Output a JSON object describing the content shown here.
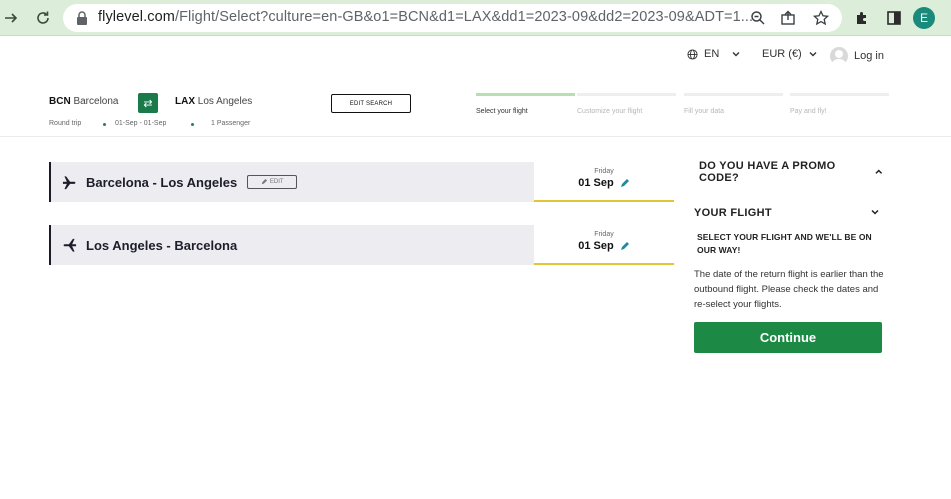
{
  "browser": {
    "url_host": "flylevel.com",
    "url_rest": "/Flight/Select?culture=en-GB&o1=BCN&d1=LAX&dd1=2023-09&dd2=2023-09&ADT=1...",
    "profile_initial": "E"
  },
  "topbar": {
    "language": "EN",
    "currency": "EUR (€)",
    "login": "Log in"
  },
  "search": {
    "origin_code": "BCN",
    "origin_city": "Barcelona",
    "dest_code": "LAX",
    "dest_city": "Los Angeles",
    "trip_type": "Round trip",
    "dates": "01-Sep - 01-Sep",
    "passengers": "1 Passenger",
    "edit_label": "EDIT SEARCH"
  },
  "steps": [
    {
      "label": "Select your flight",
      "active": true
    },
    {
      "label": "Customize your flight",
      "active": false
    },
    {
      "label": "Fill your data",
      "active": false
    },
    {
      "label": "Pay and fly!",
      "active": false
    }
  ],
  "flights": [
    {
      "route": "Barcelona - Los Angeles",
      "edit": "EDIT",
      "day": "Friday",
      "date": "01 Sep"
    },
    {
      "route": "Los Angeles - Barcelona",
      "day": "Friday",
      "date": "01 Sep"
    }
  ],
  "sidebar": {
    "promo": "DO YOU HAVE A PROMO CODE?",
    "your_flight": "YOUR FLIGHT",
    "select_msg": "SELECT YOUR FLIGHT AND WE'LL BE ON OUR WAY!",
    "warning": "The date of the return flight is earlier than the outbound flight. Please check the dates and re-select your flights.",
    "continue": "Continue"
  },
  "colors": {
    "chrome_bg": "#dcedd9",
    "brand_green": "#1c8a44",
    "date_underline": "#e2c437",
    "flight_row_bg": "#ececf1"
  }
}
